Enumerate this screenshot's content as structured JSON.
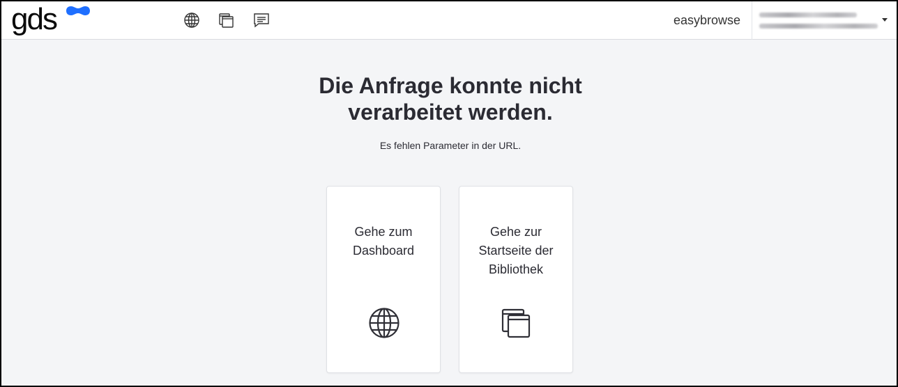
{
  "header": {
    "logo_text": "gds",
    "app_name": "easybrowse",
    "nav_icons": [
      "globe-icon",
      "library-icon",
      "chat-icon"
    ],
    "user_menu_caret": "caret-down-icon"
  },
  "main": {
    "title_line1": "Die Anfrage konnte nicht",
    "title_line2": "verarbeitet werden.",
    "message": "Es fehlen Parameter in der URL.",
    "cards": [
      {
        "lines": [
          "Gehe zum",
          "Dashboard"
        ],
        "icon": "globe-icon"
      },
      {
        "lines": [
          "Gehe zur",
          "Startseite der",
          "Bibliothek"
        ],
        "icon": "library-icon"
      }
    ]
  },
  "colors": {
    "brand_blue": "#1f6fff",
    "background": "#f4f5f7",
    "text": "#2b2b33"
  }
}
